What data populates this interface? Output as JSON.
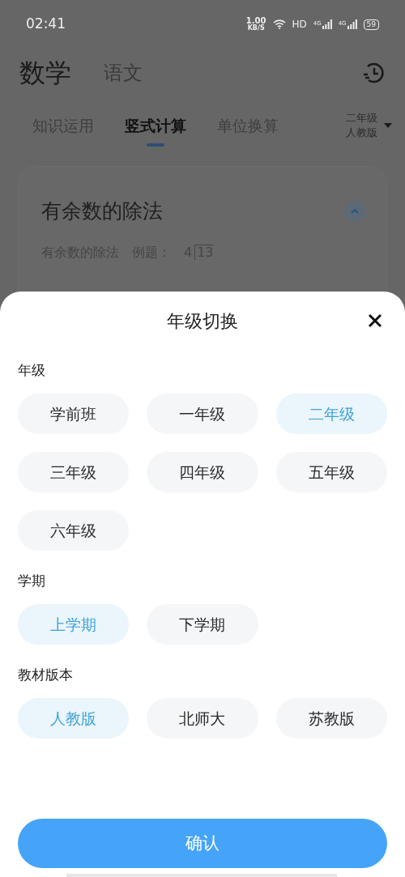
{
  "status_bar": {
    "time": "02:41",
    "speed": "1.00",
    "speed_unit": "KB/S",
    "hd": "HD",
    "networks": [
      "4G",
      "4G"
    ],
    "battery": "59"
  },
  "subjects": [
    {
      "label": "数学",
      "selected": true
    },
    {
      "label": "语文",
      "selected": false
    }
  ],
  "tabs": [
    {
      "label": "知识运用",
      "selected": false
    },
    {
      "label": "竖式计算",
      "selected": true
    },
    {
      "label": "单位换算",
      "selected": false
    }
  ],
  "grade_picker": {
    "grade": "二年级",
    "edition": "人教版"
  },
  "card": {
    "title": "有余数的除法",
    "subtitle": "有余数的除法",
    "example_label": "例题：",
    "divisor": "4",
    "dividend": "13"
  },
  "sheet": {
    "title": "年级切换",
    "sections": [
      {
        "label": "年级",
        "options": [
          {
            "label": "学前班",
            "selected": false
          },
          {
            "label": "一年级",
            "selected": false
          },
          {
            "label": "二年级",
            "selected": true
          },
          {
            "label": "三年级",
            "selected": false
          },
          {
            "label": "四年级",
            "selected": false
          },
          {
            "label": "五年级",
            "selected": false
          },
          {
            "label": "六年级",
            "selected": false
          }
        ]
      },
      {
        "label": "学期",
        "options": [
          {
            "label": "上学期",
            "selected": true
          },
          {
            "label": "下学期",
            "selected": false
          }
        ]
      },
      {
        "label": "教材版本",
        "options": [
          {
            "label": "人教版",
            "selected": true
          },
          {
            "label": "北师大",
            "selected": false
          },
          {
            "label": "苏教版",
            "selected": false
          }
        ]
      }
    ],
    "confirm": "确认"
  }
}
